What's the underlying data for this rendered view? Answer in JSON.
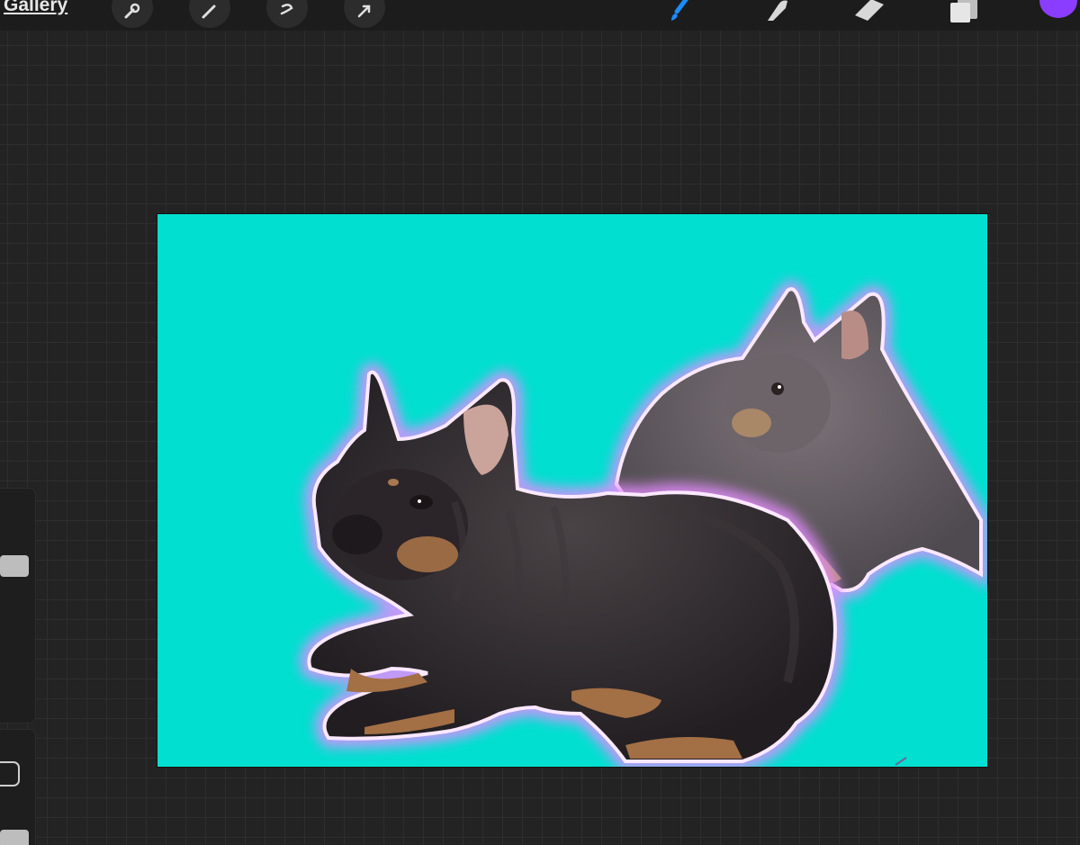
{
  "toolbar": {
    "gallery_label": "Gallery",
    "left_tools": [
      {
        "icon": "wrench-icon"
      },
      {
        "icon": "magic-wand-icon"
      },
      {
        "icon": "selection-icon"
      },
      {
        "icon": "transform-arrow-icon"
      }
    ],
    "right_tools": [
      {
        "icon": "brush-icon",
        "active": true
      },
      {
        "icon": "smudge-icon"
      },
      {
        "icon": "eraser-icon"
      },
      {
        "icon": "layers-icon"
      }
    ],
    "current_color": "#8b3dff",
    "active_tool_color": "#1a8cff"
  },
  "sidebar": {
    "controls": [
      "size-slider",
      "modify-button",
      "opacity-slider"
    ]
  },
  "canvas": {
    "background_color": "#00dfd0",
    "glow_color": "#e58cff",
    "content": [
      "black-tan-french-bulldog",
      "blue-tan-french-bulldog"
    ]
  }
}
